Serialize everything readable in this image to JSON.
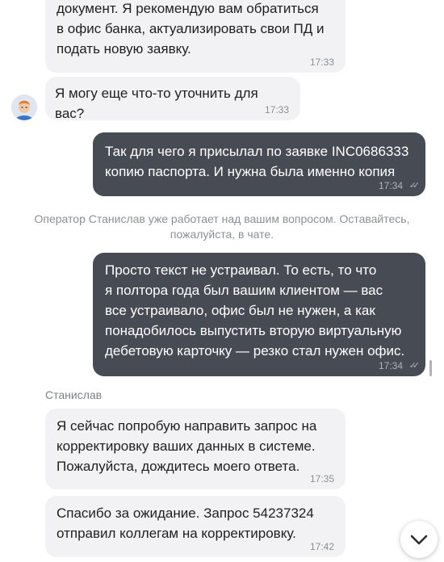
{
  "messages": [
    {
      "role": "operator",
      "text": "документ. Я рекомендую вам обратиться\nв офис банка, актуализировать свои ПД и\nподать новую заявку.",
      "time": "17:33"
    },
    {
      "role": "operator",
      "text": "Я могу еще что-то уточнить для вас?",
      "time": "17:33"
    },
    {
      "role": "user",
      "text": "Так для чего я присылал по заявке INC0686333\nкопию паспорта. И нужна была именно копия",
      "time": "17:34"
    },
    {
      "role": "user",
      "text": "Просто текст не устраивал.  То есть, то что\nя полтора года был вашим клиентом — вас\nвсе устраивало, офис был не нужен, а как\nпонадобилось выпустить вторую виртуальную\nдебетовую карточку — резко стал нужен офис.",
      "time": "17:34"
    },
    {
      "role": "operator",
      "text": "Я сейчас попробую направить запрос на\nкорректировку ваших данных в системе.\nПожалуйста, дождитесь моего ответа.",
      "time": "17:35"
    },
    {
      "role": "operator",
      "text": "Спасибо за ожидание. Запрос 54237324\nотправил коллегам на корректировку.",
      "time": "17:42"
    }
  ],
  "system_notice": "Оператор Станислав уже работает над вашим вопросом. Оставайтесь,\nпожалуйста, в чате.",
  "sender_name": "Станислав",
  "read_receipt_icon": "double-check-icon",
  "scroll_down_icon": "chevron-down-icon",
  "colors": {
    "incoming_bubble": "#f2f2f4",
    "outgoing_bubble": "#474c54",
    "page": "#ffffff"
  }
}
